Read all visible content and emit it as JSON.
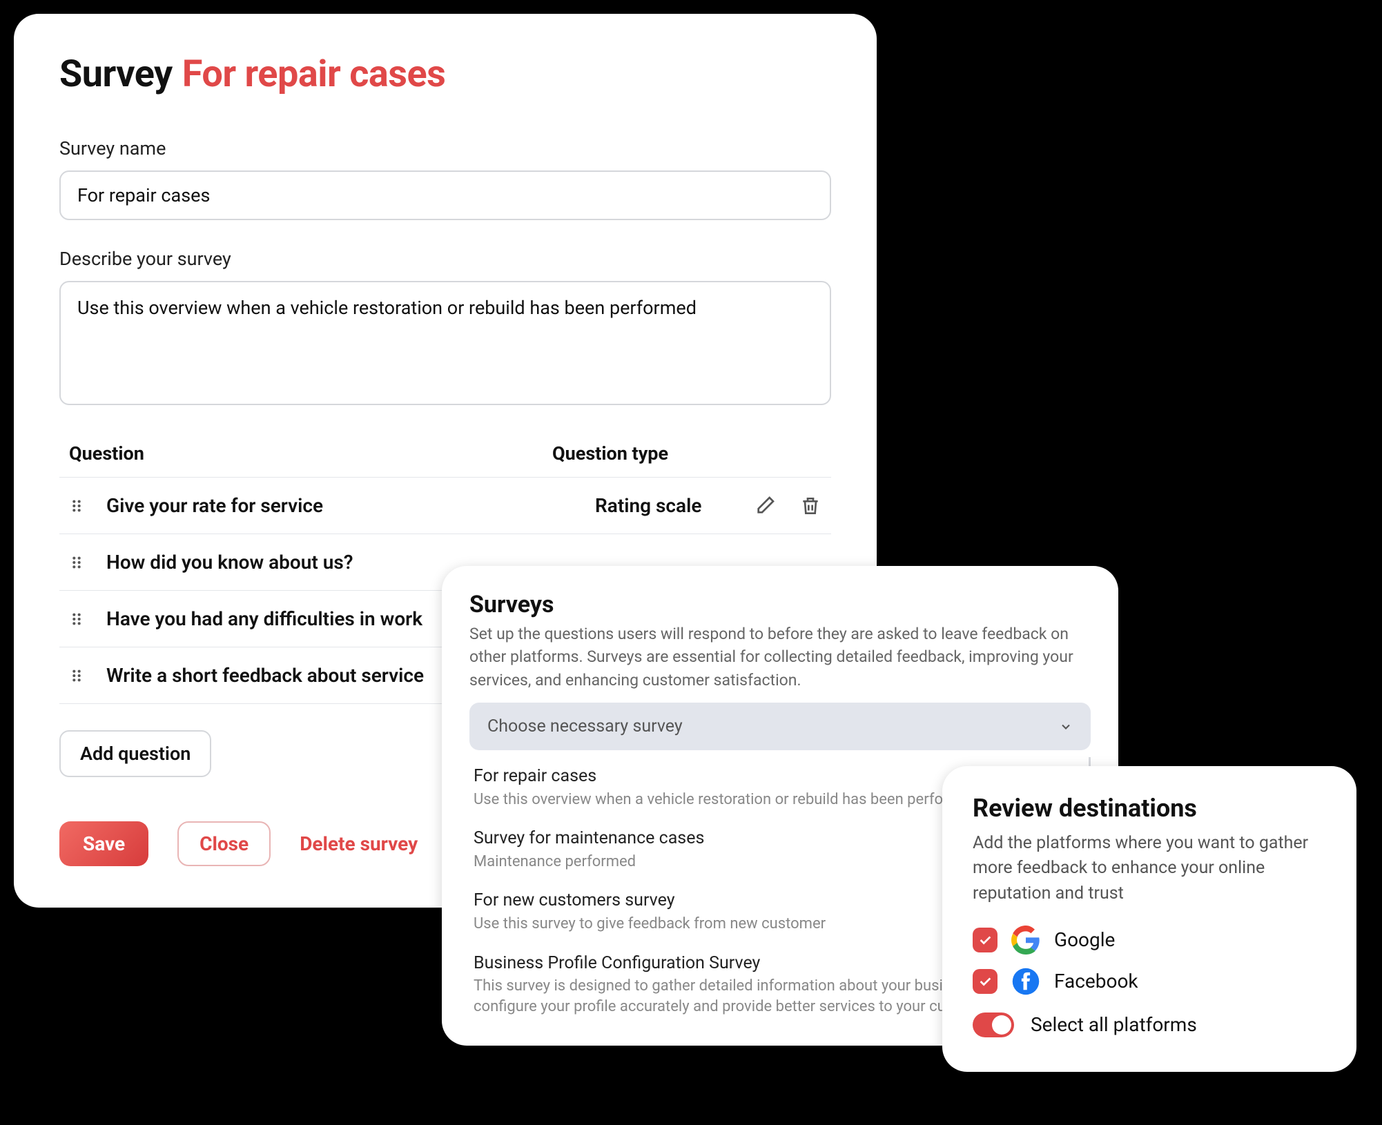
{
  "survey": {
    "title_prefix": "Survey",
    "title_name": "For repair cases",
    "name_label": "Survey name",
    "name_value": "For repair cases",
    "describe_label": "Describe your survey",
    "describe_value": "Use this overview when a vehicle restoration or rebuild has been performed",
    "table": {
      "col_question": "Question",
      "col_type": "Question type",
      "rows": [
        {
          "text": "Give your rate for service",
          "type": "Rating scale"
        },
        {
          "text": "How did you know about us?",
          "type": ""
        },
        {
          "text": "Have you had any difficulties in work",
          "type": ""
        },
        {
          "text": "Write a short feedback about service",
          "type": ""
        }
      ]
    },
    "add_question": "Add question",
    "save": "Save",
    "close": "Close",
    "delete": "Delete survey"
  },
  "picker": {
    "title": "Surveys",
    "description": "Set up the questions users will respond to before they are asked to leave feedback on other platforms. Surveys are essential for collecting detailed feedback, improving your services, and enhancing customer satisfaction.",
    "placeholder": "Choose necessary survey",
    "options": [
      {
        "name": "For repair cases",
        "desc": "Use this overview when a vehicle restoration or rebuild has been performed"
      },
      {
        "name": "Survey for maintenance cases",
        "desc": "Maintenance performed"
      },
      {
        "name": "For new customers survey",
        "desc": "Use this survey to give feedback from new customer"
      },
      {
        "name": "Business Profile Configuration Survey",
        "desc": "This survey is designed to gather detailed information about your business to help us configure your profile accurately and provide better services to your customers."
      }
    ]
  },
  "destinations": {
    "title": "Review destinations",
    "description": "Add the platforms where you want to gather more feedback to enhance your online reputation and trust",
    "items": [
      {
        "label": "Google"
      },
      {
        "label": "Facebook"
      }
    ],
    "select_all": "Select all platforms"
  }
}
